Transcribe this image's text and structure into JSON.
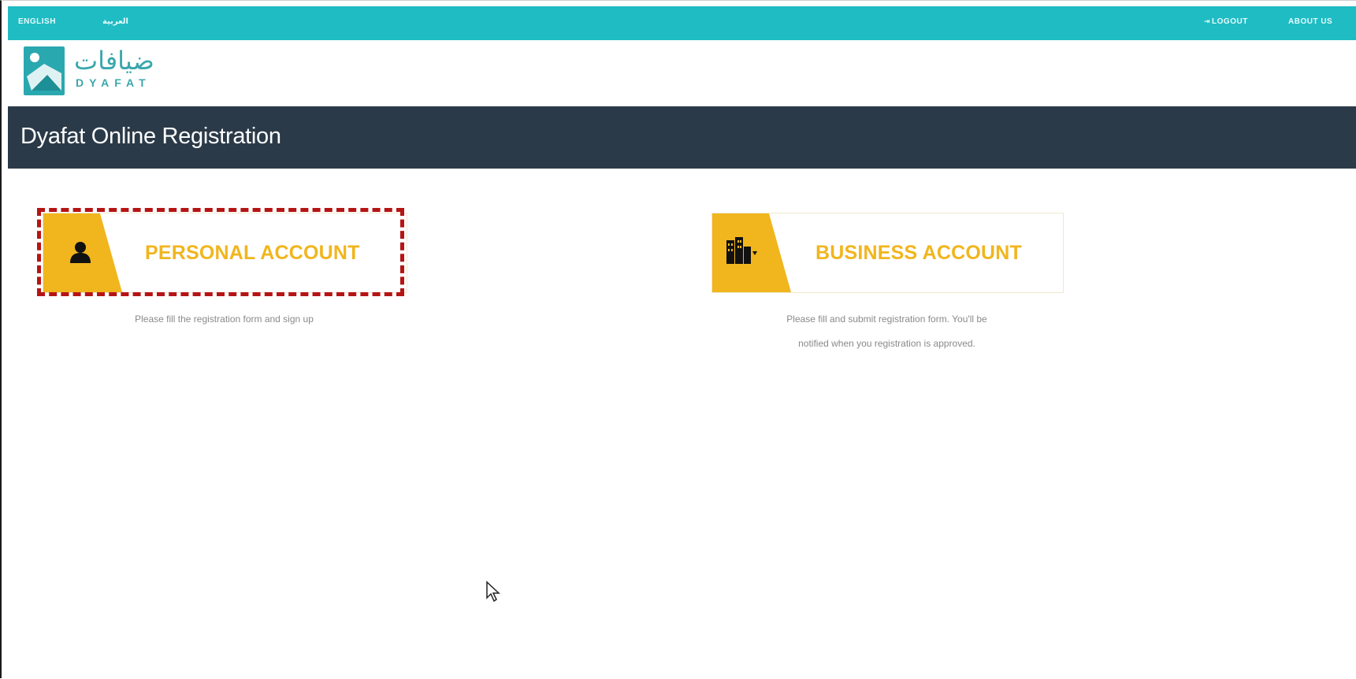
{
  "topbar": {
    "lang_english": "ENGLISH",
    "lang_arabic": "العربية",
    "logout": "LOGOUT",
    "about": "ABOUT US",
    "logout_icon": "logout-icon"
  },
  "logo": {
    "arabic": "ضيافات",
    "english": "DYAFAT",
    "icon": "dyafat-logo-icon"
  },
  "page": {
    "title": "Dyafat Online Registration"
  },
  "accounts": {
    "personal": {
      "label": "PERSONAL ACCOUNT",
      "description": "Please fill the registration form and sign up",
      "icon": "person-icon"
    },
    "business": {
      "label": "BUSINESS ACCOUNT",
      "description_line1": "Please fill and submit registration form. You'll be",
      "description_line2": "notified when you registration is approved.",
      "icon": "buildings-icon"
    }
  },
  "colors": {
    "topbar": "#1fbcc3",
    "title_bar": "#2b3a48",
    "accent": "#f1b51e",
    "highlight": "#b51414"
  }
}
